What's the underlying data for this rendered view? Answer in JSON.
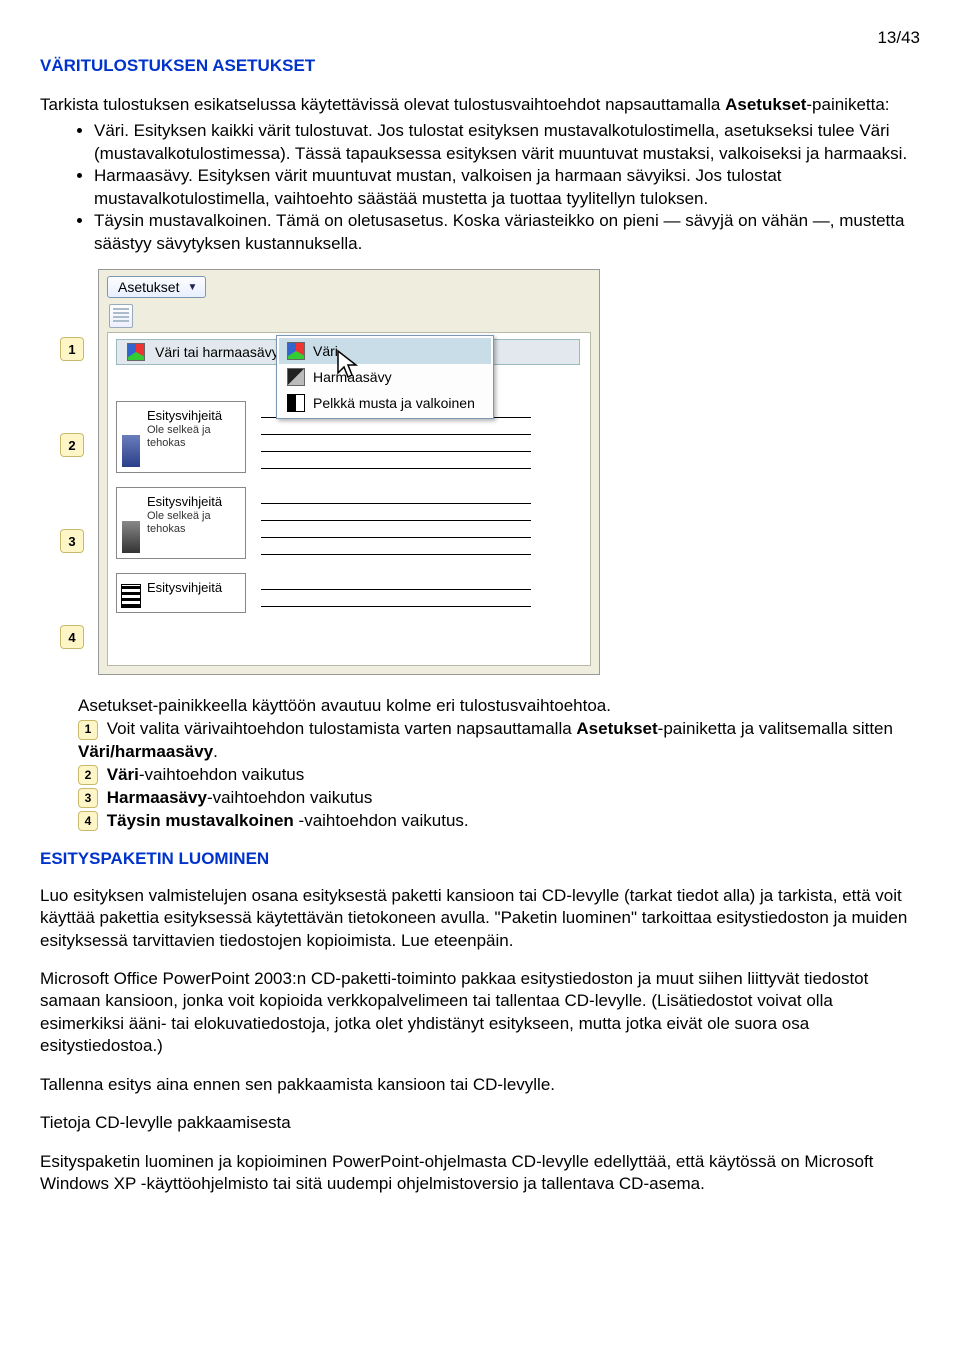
{
  "page_number": "13/43",
  "heading1": "VÄRITULOSTUKSEN ASETUKSET",
  "intro": {
    "p1a": "Tarkista tulostuksen esikatselussa käytettävissä olevat tulostusvaihtoehdot napsauttamalla ",
    "p1b": "Asetukset",
    "p1c": "-painiketta:"
  },
  "bullets": [
    "Väri. Esityksen kaikki värit tulostuvat. Jos tulostat esityksen mustavalkotulostimella, asetukseksi tulee Väri (mustavalkotulostimessa). Tässä tapauksessa esityksen värit muuntuvat mustaksi, valkoiseksi ja harmaaksi.",
    "Harmaasävy. Esityksen värit muuntuvat mustan, valkoisen ja harmaan sävyiksi. Jos tulostat mustavalkotulostimella, vaihtoehto säästää mustetta ja tuottaa tyylitellyn tuloksen.",
    "Täysin mustavalkoinen. Tämä on oletusasetus. Koska väriasteikko on pieni — sävyjä on vähän —, mustetta säästyy sävytyksen kustannuksella."
  ],
  "screenshot": {
    "button": "Asetukset",
    "row_label": "Väri tai harmaasävy",
    "submenu": [
      "Väri",
      "Harmaasävy",
      "Pelkkä musta ja valkoinen"
    ],
    "slide_title": "Esitysvihjeitä",
    "slide_sub": "Ole selkeä ja tehokas",
    "callouts": [
      "1",
      "2",
      "3",
      "4"
    ]
  },
  "after": {
    "line0": "Asetukset-painikkeella käyttöön avautuu kolme eri tulostusvaihtoehtoa.",
    "c1a": "Voit valita värivaihtoehdon tulostamista varten napsauttamalla ",
    "c1b": "Asetukset",
    "c1c": "-painiketta ja valitsemalla sitten ",
    "c1d": "Väri/harmaasävy",
    "c1e": ".",
    "c2a": "Väri",
    "c2b": "-vaihtoehdon vaikutus",
    "c3a": "Harmaasävy",
    "c3b": "-vaihtoehdon vaikutus",
    "c4a": "Täysin mustavalkoinen ",
    "c4b": "-vaihtoehdon vaikutus."
  },
  "heading2": "ESITYSPAKETIN LUOMINEN",
  "p2": "Luo esityksen valmistelujen osana esityksestä paketti kansioon tai CD-levylle (tarkat tiedot alla) ja tarkista, että voit käyttää pakettia esityksessä käytettävän tietokoneen avulla. \"Paketin luominen\" tarkoittaa esitystiedoston ja muiden esityksessä tarvittavien tiedostojen kopioimista. Lue eteenpäin.",
  "p3": "Microsoft Office PowerPoint 2003:n CD-paketti-toiminto pakkaa esitystiedoston ja muut siihen liittyvät tiedostot samaan kansioon, jonka voit kopioida verkkopalvelimeen tai tallentaa CD-levylle. (Lisätiedostot voivat olla esimerkiksi ääni- tai elokuvatiedostoja, jotka olet yhdistänyt esitykseen, mutta jotka eivät ole suora osa esitystiedostoa.)",
  "p4": "Tallenna esitys aina ennen sen pakkaamista kansioon tai CD-levylle.",
  "p5": "Tietoja CD-levylle pakkaamisesta",
  "p6": "Esityspaketin luominen ja kopioiminen PowerPoint-ohjelmasta CD-levylle edellyttää, että käytössä on Microsoft Windows XP -käyttöohjelmisto tai sitä uudempi ohjelmistoversio ja tallentava CD-asema."
}
